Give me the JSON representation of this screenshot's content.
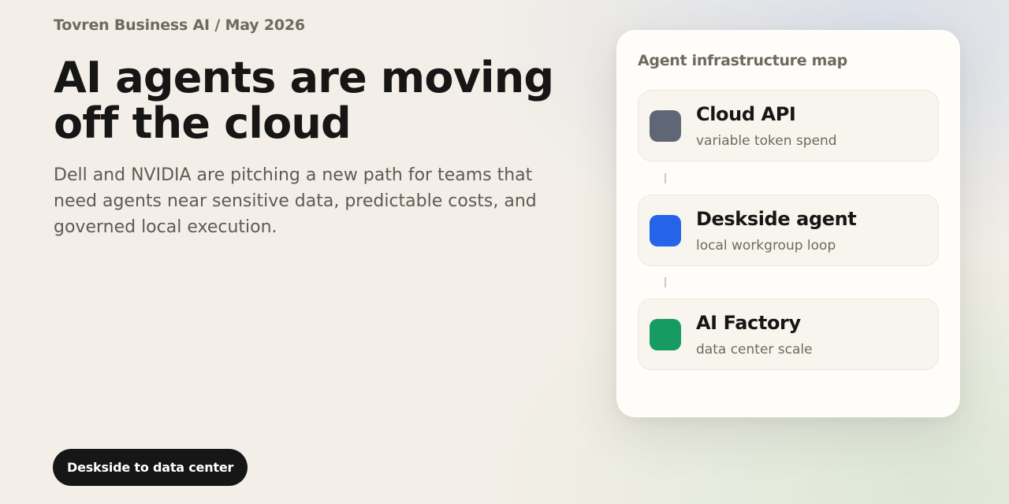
{
  "header": {
    "kicker": "Tovren Business AI / May 2026"
  },
  "hero": {
    "headline_line1": "AI agents are moving",
    "headline_line2": "off the cloud",
    "subtitle": "Dell and NVIDIA are pitching a new path for teams that need agents near sensitive data, predictable costs, and governed local execution."
  },
  "cta": {
    "label": "Deskside to data center"
  },
  "map": {
    "title": "Agent infrastructure map",
    "nodes": [
      {
        "title": "Cloud API",
        "subtitle": "variable token spend",
        "color": "#5f6675"
      },
      {
        "title": "Deskside agent",
        "subtitle": "local workgroup loop",
        "color": "#2563eb"
      },
      {
        "title": "AI Factory",
        "subtitle": "data center scale",
        "color": "#169b62"
      }
    ]
  },
  "colors": {
    "background": "#f3efe8",
    "card": "#fefdf9",
    "text": "#161616",
    "muted": "#6e6a60"
  }
}
